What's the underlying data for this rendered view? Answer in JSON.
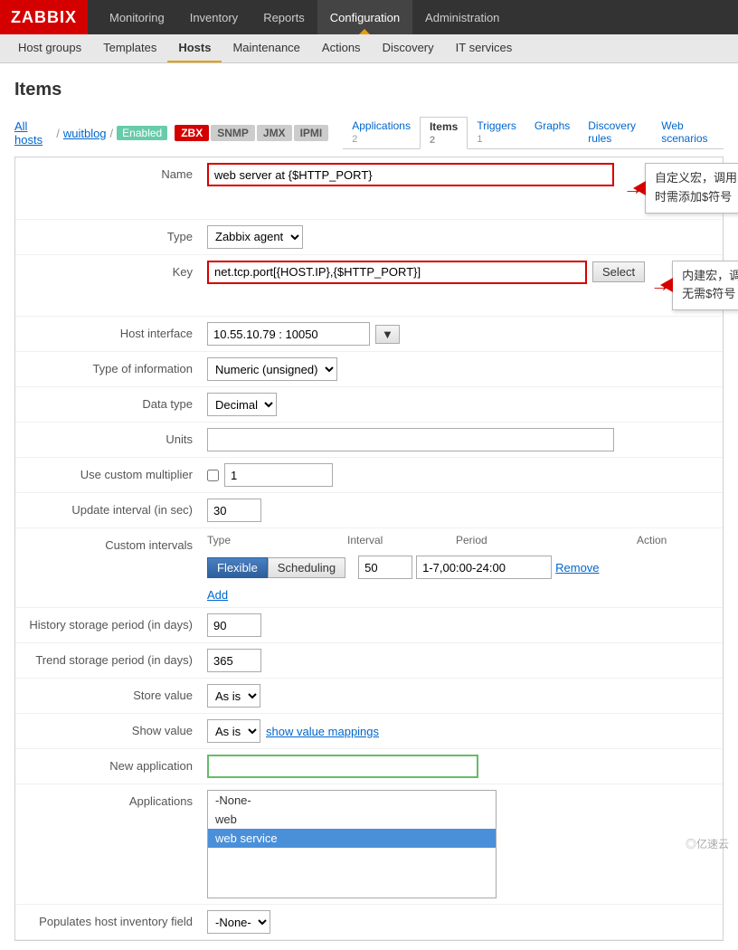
{
  "app": {
    "logo": "ZABBIX",
    "top_nav": [
      {
        "label": "Monitoring",
        "active": false
      },
      {
        "label": "Inventory",
        "active": false
      },
      {
        "label": "Reports",
        "active": false
      },
      {
        "label": "Configuration",
        "active": true
      },
      {
        "label": "Administration",
        "active": false
      }
    ],
    "second_nav": [
      {
        "label": "Host groups",
        "active": false
      },
      {
        "label": "Templates",
        "active": false
      },
      {
        "label": "Hosts",
        "active": true
      },
      {
        "label": "Maintenance",
        "active": false
      },
      {
        "label": "Actions",
        "active": false
      },
      {
        "label": "Discovery",
        "active": false
      },
      {
        "label": "IT services",
        "active": false
      }
    ]
  },
  "page": {
    "title": "Items",
    "breadcrumb": {
      "all_hosts": "All hosts",
      "sep1": "/",
      "host": "wuitblog",
      "sep2": "/",
      "status": "Enabled"
    },
    "proto_tabs": [
      "ZBX",
      "SNMP",
      "JMX",
      "IPMI"
    ],
    "item_tabs": [
      {
        "label": "Applications",
        "count": "2"
      },
      {
        "label": "Items",
        "count": "2",
        "active": true
      },
      {
        "label": "Triggers",
        "count": "1"
      },
      {
        "label": "Graphs",
        "count": ""
      },
      {
        "label": "Discovery rules",
        "count": ""
      },
      {
        "label": "Web scenarios",
        "count": ""
      }
    ]
  },
  "form": {
    "name_label": "Name",
    "name_value": "web server at {$HTTP_PORT}",
    "type_label": "Type",
    "type_value": "Zabbix agent",
    "key_label": "Key",
    "key_value": "net.tcp.port[{HOST.IP},{$HTTP_PORT}]",
    "select_btn": "Select",
    "host_interface_label": "Host interface",
    "host_interface_value": "10.55.10.79 : 10050",
    "type_info_label": "Type of information",
    "type_info_value": "Numeric (unsigned)",
    "data_type_label": "Data type",
    "data_type_value": "Decimal",
    "units_label": "Units",
    "units_value": "",
    "multiplier_label": "Use custom multiplier",
    "multiplier_value": "1",
    "update_label": "Update interval (in sec)",
    "update_value": "30",
    "custom_intervals_label": "Custom intervals",
    "intervals": {
      "col_type": "Type",
      "col_interval": "Interval",
      "col_period": "Period",
      "col_action": "Action",
      "tab_flexible": "Flexible",
      "tab_scheduling": "Scheduling",
      "interval_value": "50",
      "period_value": "1-7,00:00-24:00",
      "remove_label": "Remove",
      "add_label": "Add"
    },
    "history_label": "History storage period (in days)",
    "history_value": "90",
    "trend_label": "Trend storage period (in days)",
    "trend_value": "365",
    "store_value_label": "Store value",
    "store_value_value": "As is",
    "show_value_label": "Show value",
    "show_value_value": "As is",
    "show_value_link": "show value mappings",
    "new_app_label": "New application",
    "new_app_placeholder": "",
    "applications_label": "Applications",
    "app_list": [
      "-None-",
      "web",
      "web service"
    ],
    "app_selected": "web service",
    "host_inventory_label": "Populates host inventory field",
    "host_inventory_value": "-None-"
  },
  "annotations": {
    "ann1_line1": "自定义宏，调用",
    "ann1_line2": "时需添加$符号",
    "ann2_line1": "内建宏，调用时",
    "ann2_line2": "无需$符号"
  },
  "watermark": "◎亿速云"
}
